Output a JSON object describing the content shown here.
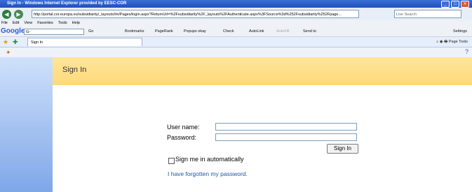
{
  "window": {
    "title": "Sign In - Windows Internet Explorer provided by EESC-COR",
    "minimize": "_",
    "maximize": "□",
    "close": "✕"
  },
  "address": {
    "url": "http://portal.cor.europa.eu/subsidiarity/_layouts/Im/Pages/login.aspx?ReturnUrl=%2Fsubsidiarity%2F_layouts%2FAuthenticate.aspx%3FSource%3d%252Fsubsidiarity%252Fpage...",
    "search_placeholder": "Live Search"
  },
  "menu": [
    "File",
    "Edit",
    "View",
    "Favorites",
    "Tools",
    "Help"
  ],
  "google_toolbar": {
    "logo": "Google",
    "search_value": "G-",
    "go": "Go",
    "bookmarks": "Bookmarks",
    "pagerank": "PageRank",
    "popups": "Popups okay",
    "check": "Check",
    "autolink": "AutoLink",
    "autofill": "AutoFill",
    "sendto": "Send to",
    "settings": "Settings"
  },
  "tabs": [
    {
      "label": "Sign In"
    }
  ],
  "commands": {
    "page": "Page",
    "tools": "Tools"
  },
  "page": {
    "header_title": "Sign In",
    "username_label": "User name:",
    "password_label": "Password:",
    "username_value": "",
    "password_value": "",
    "signin_button": "Sign In",
    "remember_label": "Sign me in automatically",
    "forgot_link": "I have forgotten my password."
  },
  "colors": {
    "banner": "#ffd97a",
    "sidebar_top": "#cfe1fb",
    "sidebar_bottom": "#7fa7e8",
    "link": "#1c57a6"
  }
}
